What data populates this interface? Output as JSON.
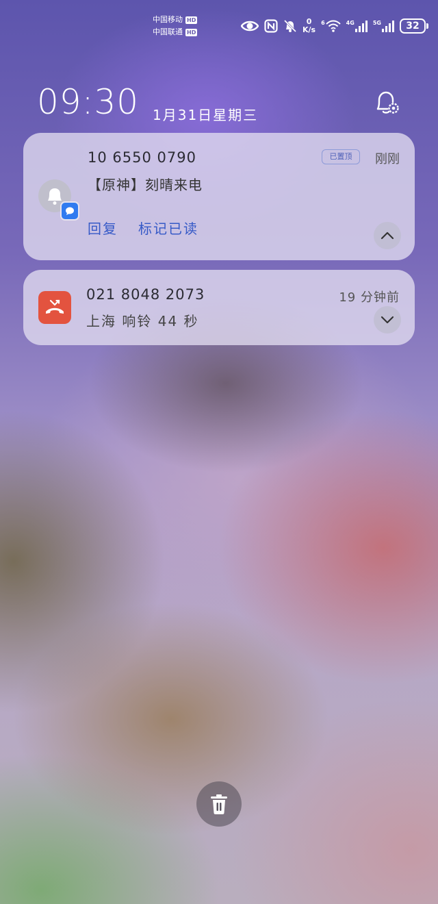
{
  "status_bar": {
    "carrier1": "中国移动",
    "carrier2": "中国联通",
    "hd_label": "HD",
    "net_speed_value": "0",
    "net_speed_unit": "K/s",
    "wifi_gen": "6",
    "sim1_type": "4G",
    "sim2_type": "5G",
    "battery": "32",
    "icons": [
      "eye-icon",
      "nfc-icon",
      "bell-off-icon",
      "wifi-icon",
      "signal-icon",
      "battery-icon"
    ]
  },
  "lockscreen": {
    "time": "09:30",
    "date": "1月31日星期三"
  },
  "notifications": [
    {
      "app_icon": "bell-icon",
      "badge_icon": "message-icon",
      "sender": "10 6550 0790",
      "pinned_label": "已置顶",
      "time": "刚刚",
      "body": "【原神】刻晴来电",
      "actions": [
        "回复",
        "标记已读"
      ]
    },
    {
      "app_icon": "missed-call-icon",
      "caller": "021 8048 2073",
      "time": "19 分钟前",
      "body": "上海 响铃 44 秒"
    }
  ],
  "colors": {
    "action_blue": "#3559c7",
    "missed_call_red": "#e3533f",
    "message_badge_blue": "#2f7bf0"
  }
}
